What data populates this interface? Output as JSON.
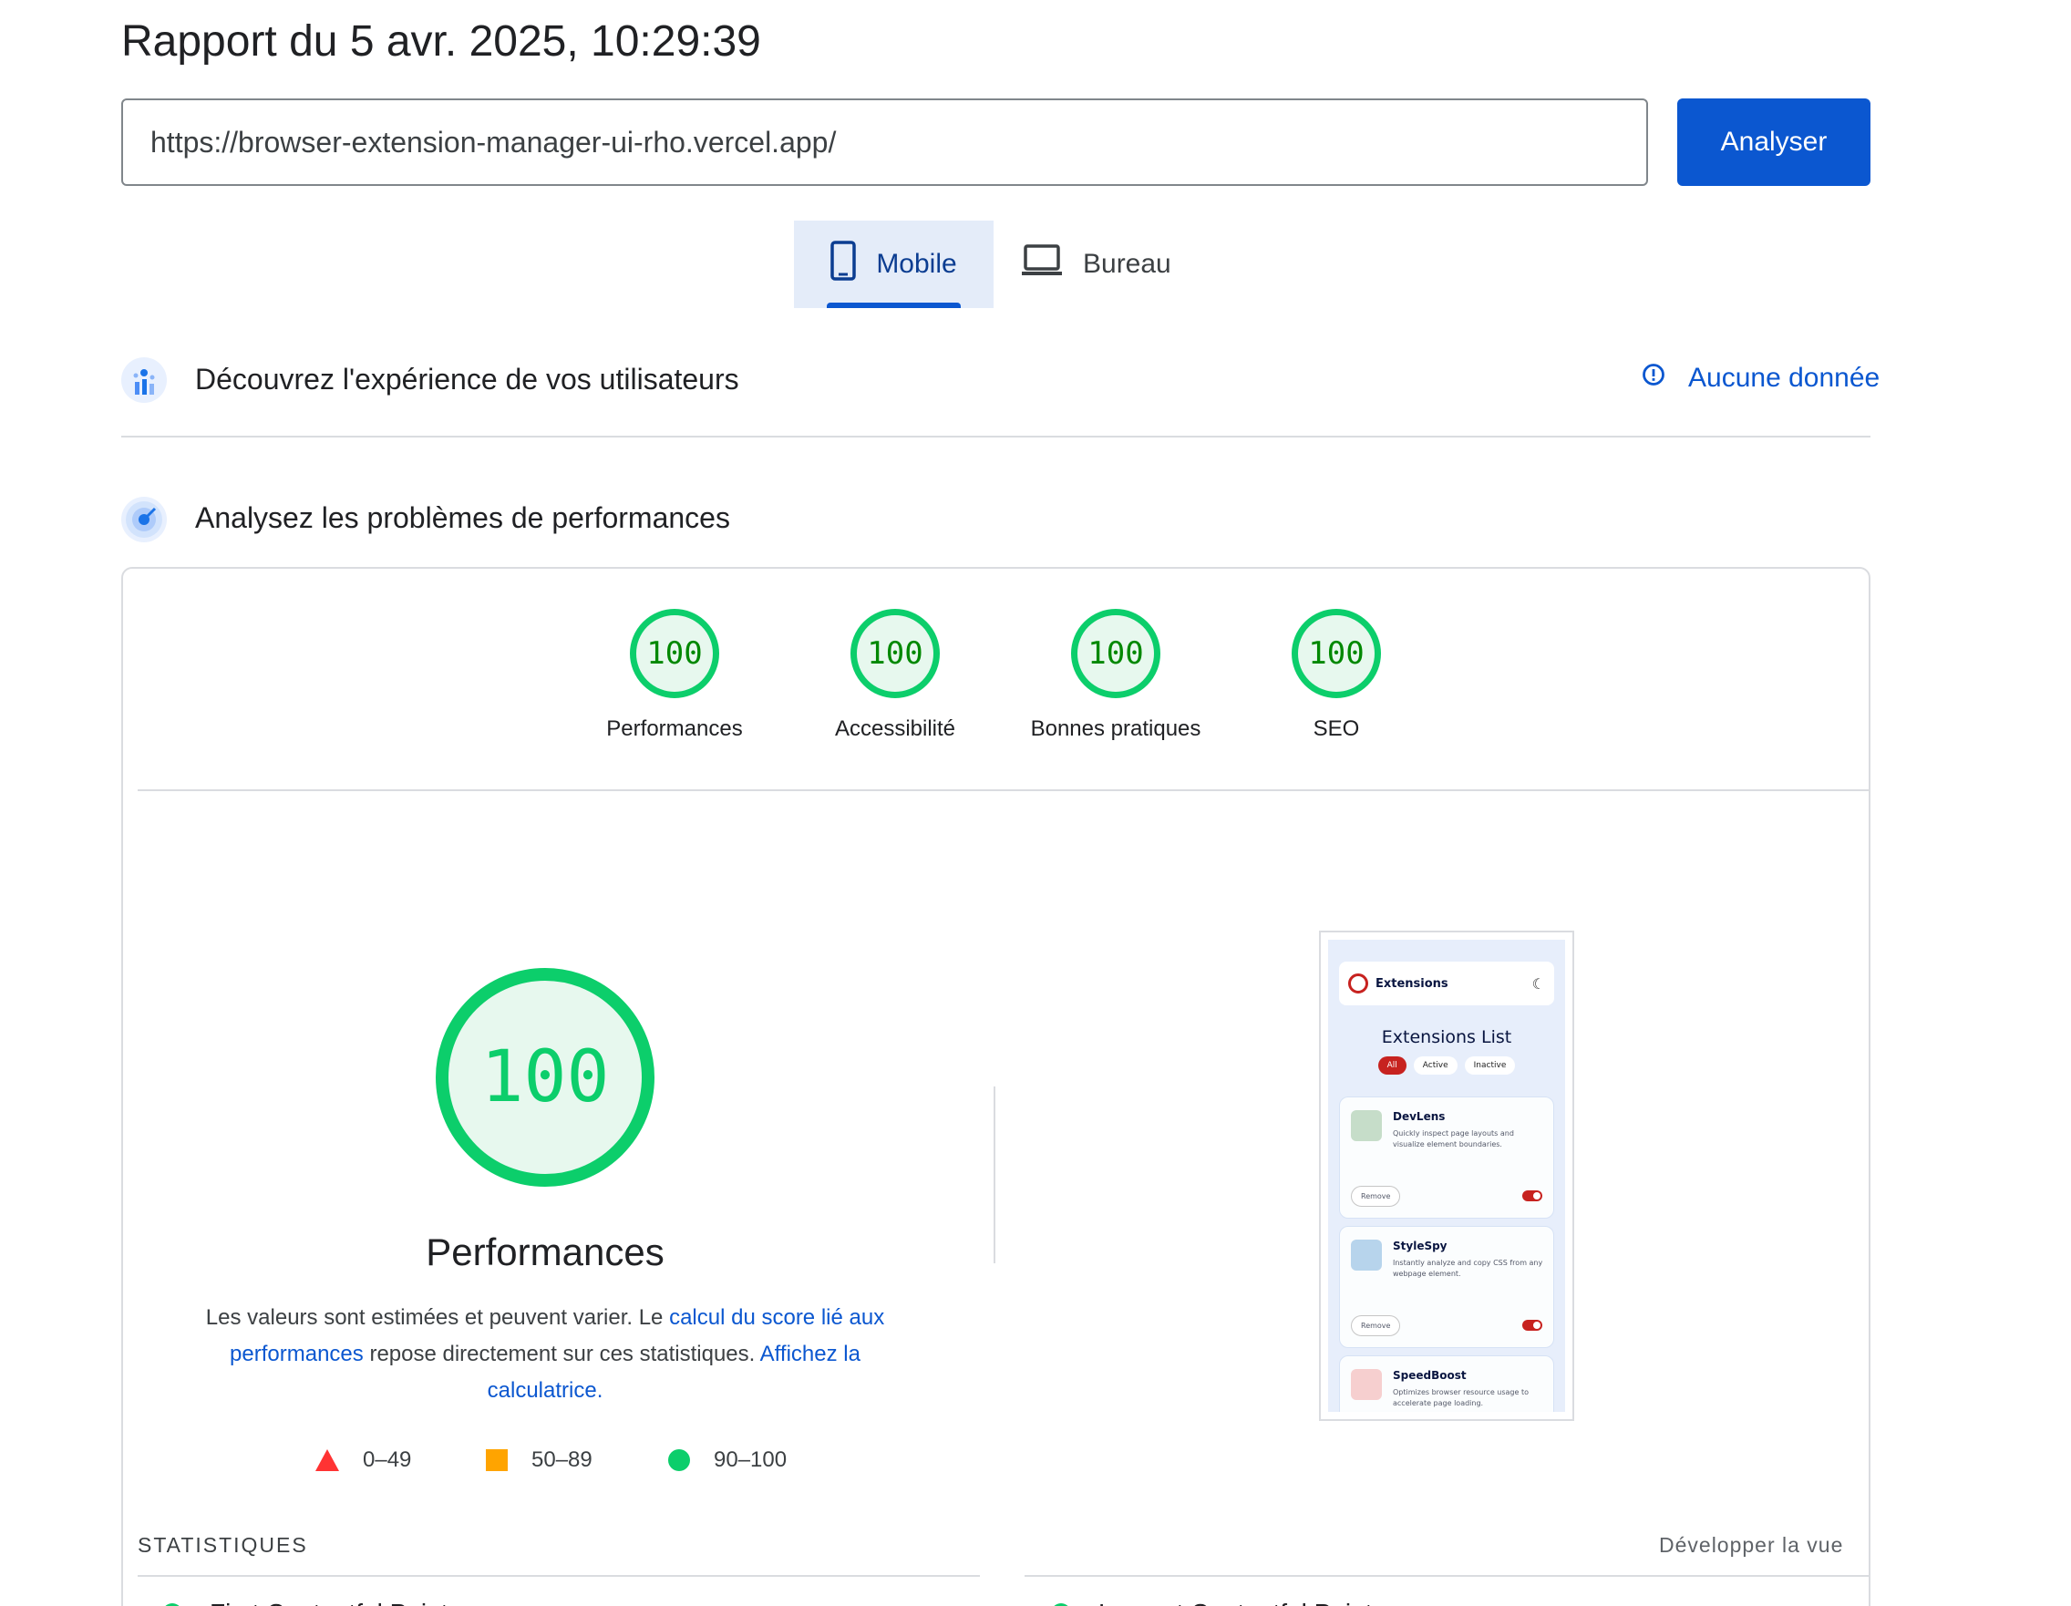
{
  "header": {
    "title": "Rapport du 5 avr. 2025, 10:29:39"
  },
  "search": {
    "url": "https://browser-extension-manager-ui-rho.vercel.app/",
    "button_label": "Analyser"
  },
  "tabs": [
    {
      "label": "Mobile",
      "selected": true,
      "icon": "smartphone-icon"
    },
    {
      "label": "Bureau",
      "selected": false,
      "icon": "laptop-icon"
    }
  ],
  "field_section": {
    "title": "Découvrez l'expérience de vos utilisateurs",
    "status_label": "Aucune donnée"
  },
  "lab_section": {
    "title": "Analysez les problèmes de performances"
  },
  "scores": [
    {
      "value": "100",
      "label": "Performances"
    },
    {
      "value": "100",
      "label": "Accessibilité"
    },
    {
      "value": "100",
      "label": "Bonnes pratiques"
    },
    {
      "value": "100",
      "label": "SEO"
    }
  ],
  "performance": {
    "score": "100",
    "title": "Performances",
    "desc_part1": "Les valeurs sont estimées et peuvent varier. Le ",
    "desc_link1": "calcul du score lié aux performances",
    "desc_part2": " repose directement sur ces statistiques. ",
    "desc_link2": "Affichez la calculatrice",
    "desc_part3": "."
  },
  "legend": [
    {
      "range": "0–49",
      "shape": "triangle",
      "color": "#ff3333"
    },
    {
      "range": "50–89",
      "shape": "square",
      "color": "#ffa400"
    },
    {
      "range": "90–100",
      "shape": "circle",
      "color": "#0cce6b"
    }
  ],
  "screenshot": {
    "brand": "Extensions",
    "list_title": "Extensions List",
    "filters": [
      "All",
      "Active",
      "Inactive"
    ],
    "remove_label": "Remove",
    "items": [
      {
        "name": "DevLens",
        "description": "Quickly inspect page layouts and visualize element boundaries."
      },
      {
        "name": "StyleSpy",
        "description": "Instantly analyze and copy CSS from any webpage element."
      },
      {
        "name": "SpeedBoost",
        "description": "Optimizes browser resource usage to accelerate page loading."
      }
    ]
  },
  "metrics": {
    "section_label": "STATISTIQUES",
    "expand_label": "Développer la vue",
    "items": [
      {
        "name": "First Contentful Paint",
        "status_color": "#0cce6b"
      },
      {
        "name": "Largest Contentful Paint",
        "status_color": "#0cce6b"
      }
    ]
  },
  "colors": {
    "accent": "#0b57d0",
    "pass": "#0cce6b",
    "pass_text": "#008800"
  }
}
